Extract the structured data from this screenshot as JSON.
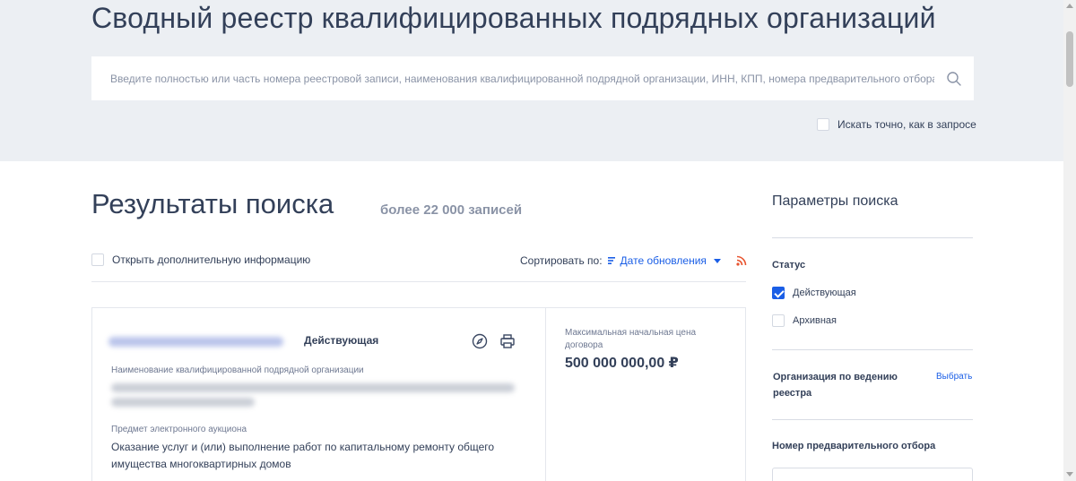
{
  "header": {
    "title": "Сводный реестр квалифицированных подрядных организаций",
    "search_placeholder": "Введите полностью или часть номера реестровой записи, наименования квалифицированной подрядной организации, ИНН, КПП, номера предварительного отбора",
    "exact_search_label": "Искать точно, как в запросе",
    "exact_search_checked": false
  },
  "results": {
    "title": "Результаты поиска",
    "count": "более 22 000 записей",
    "extra_info_label": "Открыть дополнительную информацию",
    "sort_label": "Сортировать по:",
    "sort_value": "Дате обновления"
  },
  "card": {
    "status": "Действующая",
    "org_name_label": "Наименование квалифицированной подрядной организации",
    "subject_label": "Предмет электронного аукциона",
    "subject": "Оказание услуг и (или) выполнение работ по капитальному ремонту общего имущества многоквартирных домов",
    "price_label": "Максимальная начальная цена договора",
    "price": "500 000 000,00 ₽"
  },
  "sidebar": {
    "title": "Параметры поиска",
    "status_heading": "Статус",
    "status_options": [
      {
        "label": "Действующая",
        "checked": true
      },
      {
        "label": "Архивная",
        "checked": false
      }
    ],
    "org_heading": "Организация по ведению реестра",
    "choose_link": "Выбрать",
    "preselection_heading": "Номер предварительного отбора"
  },
  "colors": {
    "accent": "#1a5ee6",
    "header_bg": "#eceff3",
    "text": "#334059",
    "muted": "#8a93a6",
    "rss": "#e8542f"
  },
  "icons": [
    "search-icon",
    "sort-lines-icon",
    "chevron-down-icon",
    "rss-icon",
    "compass-icon",
    "print-icon"
  ]
}
